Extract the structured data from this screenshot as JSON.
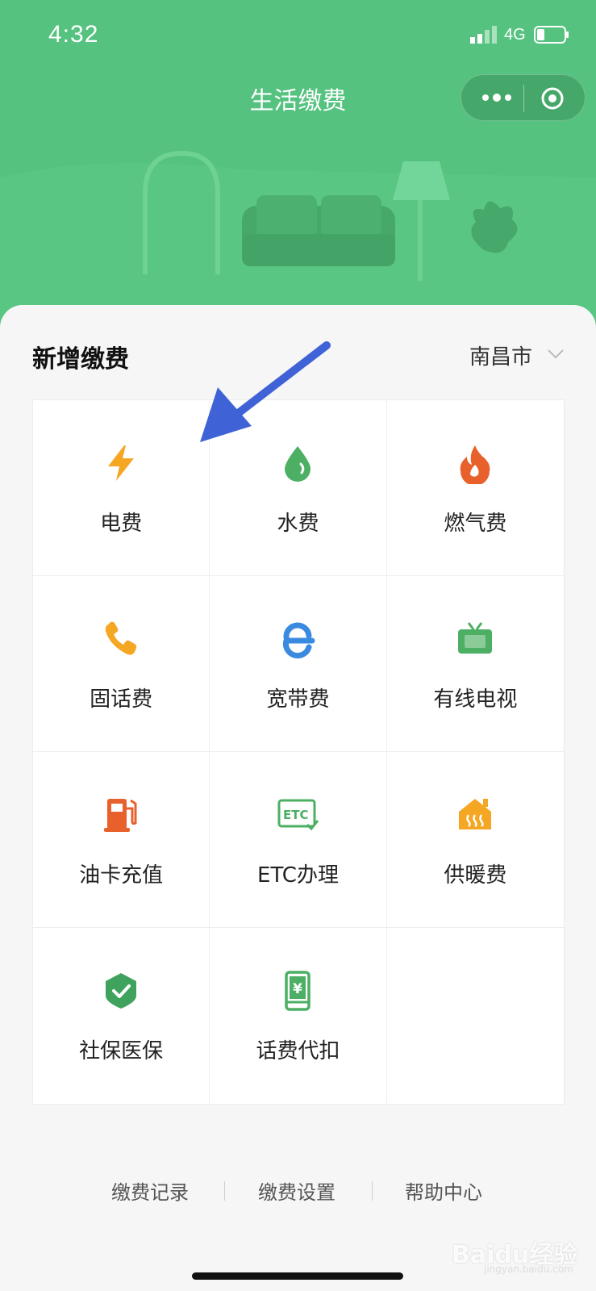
{
  "status_bar": {
    "time": "4:32",
    "network": "4G"
  },
  "nav": {
    "title": "生活缴费"
  },
  "section": {
    "title": "新增缴费",
    "city": "南昌市"
  },
  "services": [
    {
      "label": "电费",
      "icon": "lightning-icon",
      "color": "#f5a623"
    },
    {
      "label": "水费",
      "icon": "water-drop-icon",
      "color": "#4caf63"
    },
    {
      "label": "燃气费",
      "icon": "flame-icon",
      "color": "#e8602c"
    },
    {
      "label": "固话费",
      "icon": "phone-icon",
      "color": "#f5a623"
    },
    {
      "label": "宽带费",
      "icon": "browser-e-icon",
      "color": "#3a8be0"
    },
    {
      "label": "有线电视",
      "icon": "tv-icon",
      "color": "#4caf63"
    },
    {
      "label": "油卡充值",
      "icon": "fuel-pump-icon",
      "color": "#e8602c"
    },
    {
      "label": "ETC办理",
      "icon": "etc-card-icon",
      "color": "#4caf63"
    },
    {
      "label": "供暖费",
      "icon": "heating-house-icon",
      "color": "#f5a623"
    },
    {
      "label": "社保医保",
      "icon": "shield-check-icon",
      "color": "#3fa25d"
    },
    {
      "label": "话费代扣",
      "icon": "mobile-yuan-icon",
      "color": "#4caf63"
    }
  ],
  "footer": {
    "links": [
      "缴费记录",
      "缴费设置",
      "帮助中心"
    ]
  },
  "watermark": {
    "text": "Baidu经验",
    "sub": "jingyan.baidu.com"
  },
  "colors": {
    "header_bg": "#55c27f",
    "accent_green": "#4caf63",
    "annotation_arrow": "#3f63d6"
  }
}
